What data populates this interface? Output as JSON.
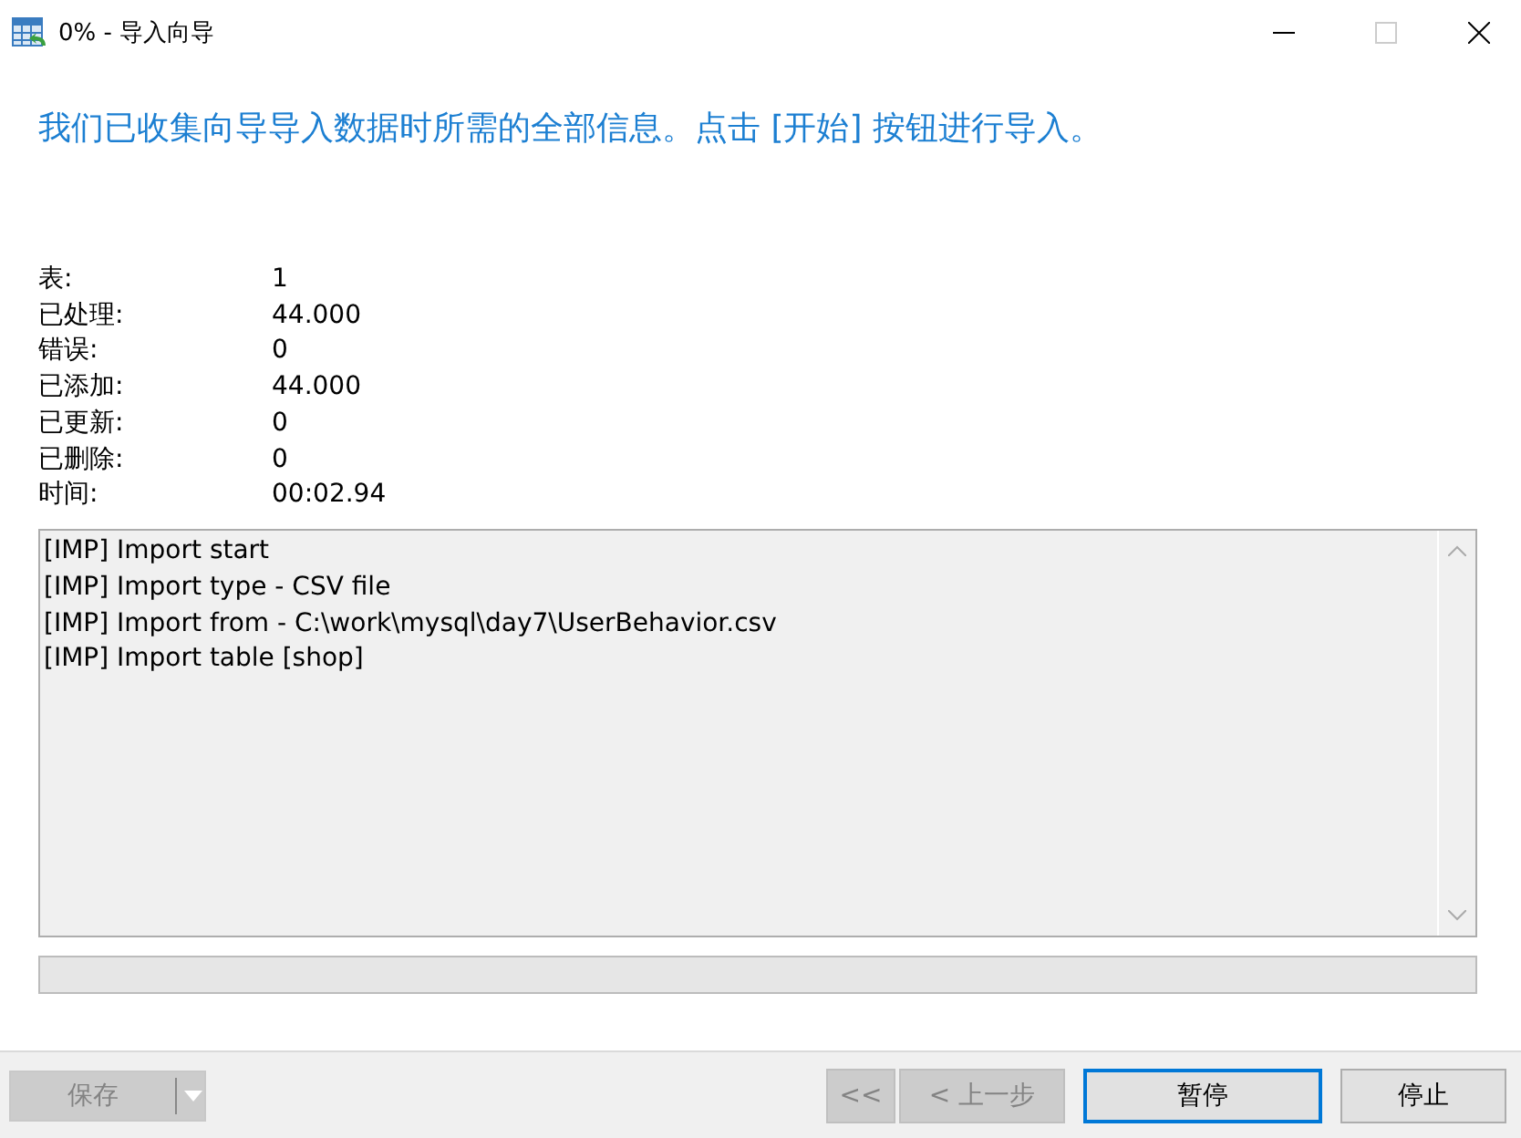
{
  "window": {
    "title": "0% - 导入向导"
  },
  "heading": "我们已收集向导导入数据时所需的全部信息。点击 [开始] 按钮进行导入。",
  "stats": [
    {
      "label": "表:",
      "value": "1"
    },
    {
      "label": "已处理:",
      "value": "44.000"
    },
    {
      "label": "错误:",
      "value": "0"
    },
    {
      "label": "已添加:",
      "value": "44.000"
    },
    {
      "label": "已更新:",
      "value": "0"
    },
    {
      "label": "已删除:",
      "value": "0"
    },
    {
      "label": "时间:",
      "value": "00:02.94"
    }
  ],
  "log": [
    "[IMP] Import start",
    "[IMP] Import type - CSV file",
    "[IMP] Import from - C:\\work\\mysql\\day7\\UserBehavior.csv",
    "[IMP] Import table [shop]"
  ],
  "progress": {
    "level": 0
  },
  "save_button": {
    "label": "保存",
    "disabled": true
  },
  "buttons": [
    {
      "label": "<<",
      "disabled": true,
      "focused": false
    },
    {
      "label": "< 上一步",
      "disabled": true,
      "focused": false
    },
    {
      "label": "暂停",
      "disabled": false,
      "focused": true
    },
    {
      "label": "停止",
      "disabled": false,
      "focused": false
    }
  ]
}
